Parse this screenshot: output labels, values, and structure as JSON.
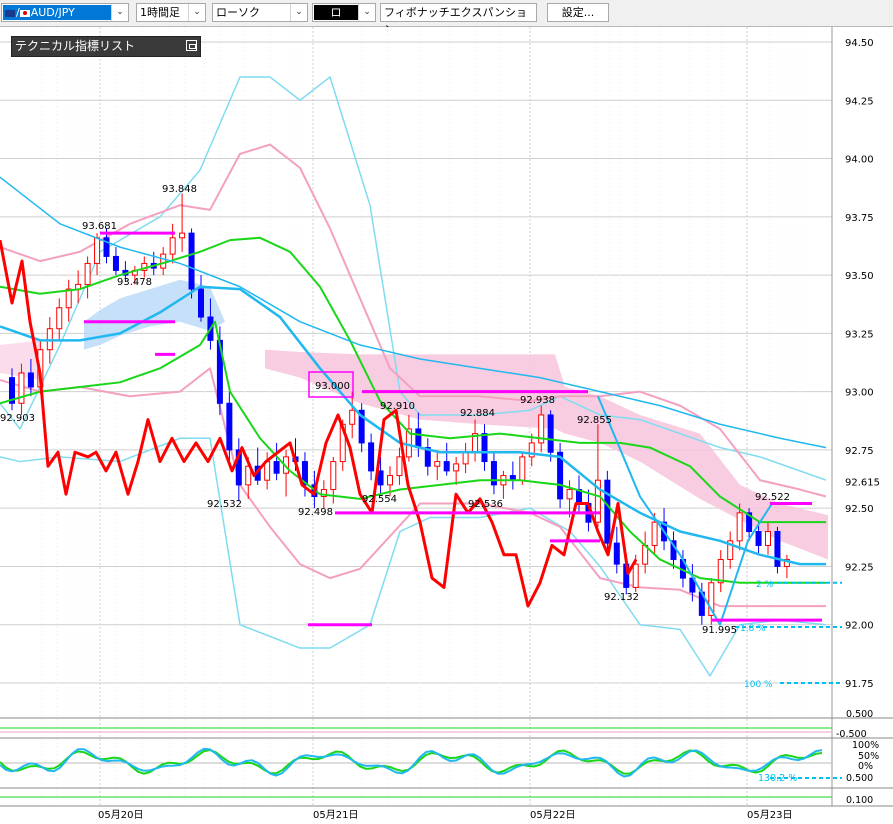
{
  "toolbar": {
    "symbol": "AUD/JPY",
    "period": "1時間足",
    "chart_type": "ローソク",
    "draw_tool": "ロ",
    "tool_name": "フィボナッチエクスパンション",
    "settings_label": "設定..."
  },
  "indicator_list_label": "テクニカル指標リスト",
  "colors": {
    "up_candle": "#ff0000",
    "down_candle": "#0000ff",
    "bollinger_outer": "#7fdcf0",
    "bollinger_inner": "#f4a0c0",
    "ma_green": "#19d619",
    "ma_blue": "#20b8ef",
    "rci_red": "#ff0000",
    "cloud": "#f8c4dc",
    "fibo_magenta": "#ff00ff",
    "fibo_cyan": "#00c0f0"
  },
  "chart_data": {
    "type": "candlestick",
    "symbol": "AUD/JPY",
    "timeframe": "1時間足",
    "ylim": [
      91.75,
      94.5
    ],
    "y_ticks": [
      "94.50",
      "94.25",
      "94.00",
      "93.75",
      "93.50",
      "93.25",
      "93.00",
      "92.75",
      "92.50",
      "92.25",
      "92.00",
      "91.75"
    ],
    "current_price": "92.615",
    "x_labels": [
      "05月20日",
      "05月21日",
      "05月22日",
      "05月23日"
    ],
    "price_labels": [
      "93.848",
      "93.681",
      "93.478",
      "92.903",
      "92.532",
      "93.000",
      "92.498",
      "92.910",
      "92.554",
      "92.884",
      "92.536",
      "92.938",
      "92.855",
      "92.132",
      "92.522",
      "91.995"
    ],
    "fibo_labels": [
      "100 %"
    ],
    "fibo_partial_labels": [
      "2 %",
      "1.8 %"
    ],
    "oscillator_labels": [
      "0.500",
      "-0.500",
      "100%",
      "50%",
      "0%",
      "0.500",
      "130.2 %",
      "0.100"
    ],
    "candles": [
      [
        93.06,
        93.1,
        92.92,
        92.95
      ],
      [
        92.95,
        93.12,
        92.9,
        93.08
      ],
      [
        93.08,
        93.14,
        92.98,
        93.02
      ],
      [
        93.02,
        93.22,
        92.99,
        93.18
      ],
      [
        93.18,
        93.32,
        93.12,
        93.27
      ],
      [
        93.27,
        93.4,
        93.22,
        93.36
      ],
      [
        93.36,
        93.48,
        93.3,
        93.44
      ],
      [
        93.44,
        93.52,
        93.38,
        93.46
      ],
      [
        93.46,
        93.58,
        93.4,
        93.55
      ],
      [
        93.55,
        93.68,
        93.5,
        93.66
      ],
      [
        93.66,
        93.7,
        93.55,
        93.58
      ],
      [
        93.58,
        93.62,
        93.5,
        93.52
      ],
      [
        93.52,
        93.56,
        93.47,
        93.5
      ],
      [
        93.5,
        93.54,
        93.46,
        93.52
      ],
      [
        93.52,
        93.58,
        93.49,
        93.55
      ],
      [
        93.55,
        93.6,
        93.5,
        93.53
      ],
      [
        93.53,
        93.62,
        93.5,
        93.59
      ],
      [
        93.59,
        93.72,
        93.55,
        93.66
      ],
      [
        93.66,
        93.85,
        93.6,
        93.68
      ],
      [
        93.68,
        93.7,
        93.4,
        93.44
      ],
      [
        93.44,
        93.5,
        93.3,
        93.32
      ],
      [
        93.32,
        93.4,
        93.18,
        93.22
      ],
      [
        93.22,
        93.28,
        92.9,
        92.95
      ],
      [
        92.95,
        93.0,
        92.7,
        92.75
      ],
      [
        92.75,
        92.8,
        92.53,
        92.6
      ],
      [
        92.6,
        92.72,
        92.54,
        92.68
      ],
      [
        92.68,
        92.76,
        92.6,
        92.62
      ],
      [
        92.62,
        92.74,
        92.58,
        92.7
      ],
      [
        92.7,
        92.78,
        92.62,
        92.65
      ],
      [
        92.65,
        92.75,
        92.55,
        92.72
      ],
      [
        92.72,
        92.8,
        92.66,
        92.7
      ],
      [
        92.7,
        92.74,
        92.55,
        92.6
      ],
      [
        92.6,
        92.66,
        92.5,
        92.55
      ],
      [
        92.55,
        92.62,
        92.5,
        92.58
      ],
      [
        92.58,
        92.72,
        92.52,
        92.7
      ],
      [
        92.7,
        92.88,
        92.66,
        92.86
      ],
      [
        92.86,
        93.0,
        92.8,
        92.92
      ],
      [
        92.92,
        92.95,
        92.74,
        92.78
      ],
      [
        92.78,
        92.82,
        92.62,
        92.66
      ],
      [
        92.66,
        92.72,
        92.56,
        92.6
      ],
      [
        92.6,
        92.68,
        92.55,
        92.64
      ],
      [
        92.64,
        92.76,
        92.6,
        92.72
      ],
      [
        92.72,
        92.9,
        92.7,
        92.84
      ],
      [
        92.84,
        92.91,
        92.72,
        92.76
      ],
      [
        92.76,
        92.8,
        92.64,
        92.68
      ],
      [
        92.68,
        92.74,
        92.62,
        92.7
      ],
      [
        92.7,
        92.78,
        92.64,
        92.66
      ],
      [
        92.66,
        92.72,
        92.6,
        92.69
      ],
      [
        92.69,
        92.78,
        92.65,
        92.74
      ],
      [
        92.74,
        92.88,
        92.7,
        92.82
      ],
      [
        92.82,
        92.86,
        92.66,
        92.7
      ],
      [
        92.7,
        92.74,
        92.56,
        92.6
      ],
      [
        92.6,
        92.66,
        92.54,
        92.64
      ],
      [
        92.64,
        92.7,
        92.58,
        92.62
      ],
      [
        92.62,
        92.74,
        92.6,
        92.72
      ],
      [
        92.72,
        92.82,
        92.68,
        92.78
      ],
      [
        92.78,
        92.94,
        92.74,
        92.9
      ],
      [
        92.9,
        92.92,
        92.7,
        92.74
      ],
      [
        92.74,
        92.78,
        92.5,
        92.54
      ],
      [
        92.54,
        92.62,
        92.46,
        92.58
      ],
      [
        92.58,
        92.64,
        92.48,
        92.52
      ],
      [
        92.52,
        92.58,
        92.4,
        92.44
      ],
      [
        92.44,
        92.86,
        92.42,
        92.62
      ],
      [
        92.62,
        92.66,
        92.3,
        92.35
      ],
      [
        92.35,
        92.42,
        92.22,
        92.26
      ],
      [
        92.26,
        92.3,
        92.13,
        92.16
      ],
      [
        92.16,
        92.3,
        92.14,
        92.26
      ],
      [
        92.26,
        92.4,
        92.22,
        92.34
      ],
      [
        92.34,
        92.48,
        92.3,
        92.44
      ],
      [
        92.44,
        92.5,
        92.32,
        92.36
      ],
      [
        92.36,
        92.4,
        92.24,
        92.28
      ],
      [
        92.28,
        92.32,
        92.16,
        92.2
      ],
      [
        92.2,
        92.26,
        92.1,
        92.14
      ],
      [
        92.14,
        92.18,
        92.0,
        92.04
      ],
      [
        92.04,
        92.2,
        92.0,
        92.18
      ],
      [
        92.18,
        92.32,
        92.14,
        92.28
      ],
      [
        92.28,
        92.4,
        92.24,
        92.36
      ],
      [
        92.36,
        92.52,
        92.32,
        92.48
      ],
      [
        92.48,
        92.5,
        92.36,
        92.4
      ],
      [
        92.4,
        92.44,
        92.3,
        92.34
      ],
      [
        92.34,
        92.44,
        92.3,
        92.4
      ],
      [
        92.4,
        92.42,
        92.22,
        92.25
      ],
      [
        92.25,
        92.3,
        92.2,
        92.28
      ]
    ]
  }
}
